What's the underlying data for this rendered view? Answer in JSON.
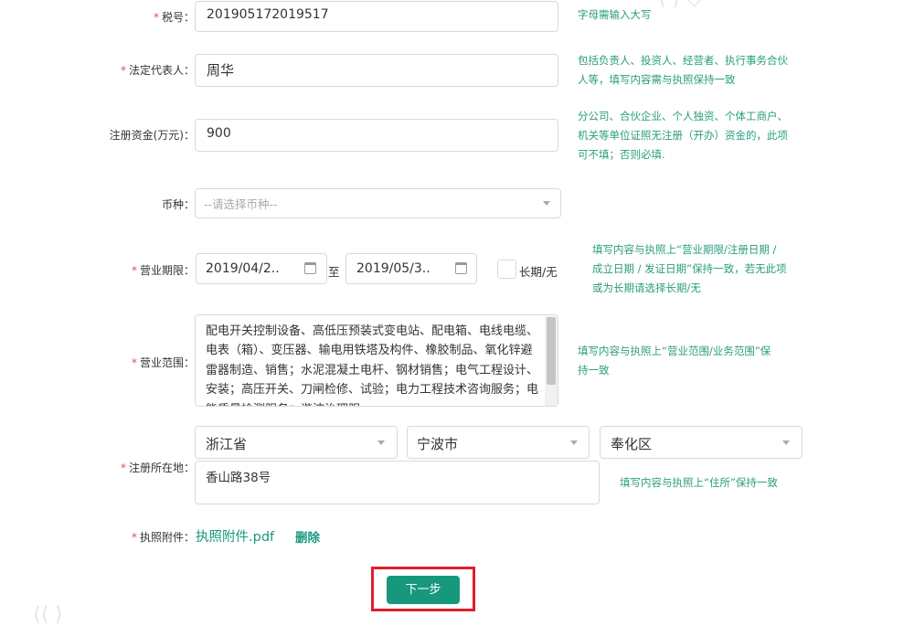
{
  "form": {
    "tax_no": {
      "label": "税号：",
      "value": "201905172019517",
      "hint": "字母需输入大写"
    },
    "legal_rep": {
      "label": "法定代表人：",
      "value": "周华",
      "hint_lines": [
        "包括负责人、投资人、经营者、执行事务合伙",
        "人等，填写内容需与执照保持一致"
      ]
    },
    "capital": {
      "label": "注册资金(万元)：",
      "value": "900",
      "hint_lines": [
        "分公司、合伙企业、个人独资、个体工商户、",
        "机关等单位证照无注册（开办）资金的，此项",
        "可不填；否则必填."
      ]
    },
    "currency": {
      "label": "币种：",
      "placeholder": "--请选择币种--"
    },
    "term": {
      "label": "营业期限：",
      "start": "2019/04/2..",
      "separator": "至",
      "end": "2019/05/3..",
      "long_term_label": "长期/无",
      "long_term_checked": false,
      "hint_lines": [
        "填写内容与执照上“营业期限/注册日期 /",
        "成立日期 / 发证日期”保持一致，若无此项",
        "或为长期请选择长期/无"
      ]
    },
    "scope": {
      "label": "营业范围：",
      "value": "配电开关控制设备、高低压预装式变电站、配电箱、电线电缆、电表（箱）、变压器、输电用铁塔及构件、橡胶制品、氧化锌避雷器制造、销售；水泥混凝土电杆、钢材销售；电气工程设计、安装；高压开关、刀闸检修、试验；电力工程技术咨询服务；电能质量检测服务；谐波治理服",
      "hint_lines": [
        "填写内容与执照上“营业范围/业务范围”保",
        "持一致"
      ]
    },
    "address": {
      "label": "注册所在地：",
      "province": "浙江省",
      "city": "宁波市",
      "district": "奉化区",
      "street": "香山路38号",
      "hint": "填写内容与执照上“住所”保持一致"
    },
    "attachment": {
      "label": "执照附件：",
      "file": "执照附件.pdf",
      "delete": "删除"
    },
    "next_button": "下一步"
  },
  "colors": {
    "accent": "#17987c",
    "hint": "#2a9d7f",
    "required": "#e94b4b",
    "highlight": "#e01e2a"
  },
  "icons": [
    "calendar-icon",
    "chevron-down-icon"
  ]
}
